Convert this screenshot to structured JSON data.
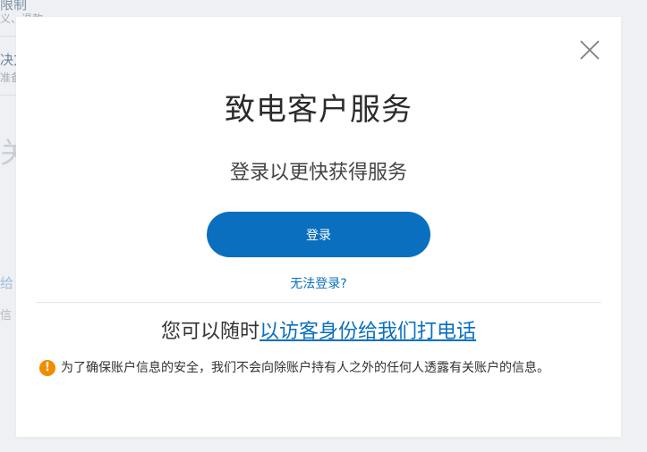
{
  "background": {
    "lines": [
      "限制",
      "义、退款",
      "决方",
      "准备",
      "关系",
      "给",
      "信"
    ]
  },
  "modal": {
    "close_label": "×",
    "title": "致电客户服务",
    "subtitle": "登录以更快获得服务",
    "login_button": "登录",
    "cant_login_link": "无法登录?",
    "guest_prefix": "您可以随时",
    "guest_link": "以访客身份给我们打电话",
    "notice_icon": "!",
    "notice_text": "为了确保账户信息的安全，我们不会向除账户持有人之外的任何人透露有关账户的信息。"
  },
  "colors": {
    "accent": "#0a6fbe",
    "warning": "#f08c00",
    "overlay": "#eef0f3"
  }
}
